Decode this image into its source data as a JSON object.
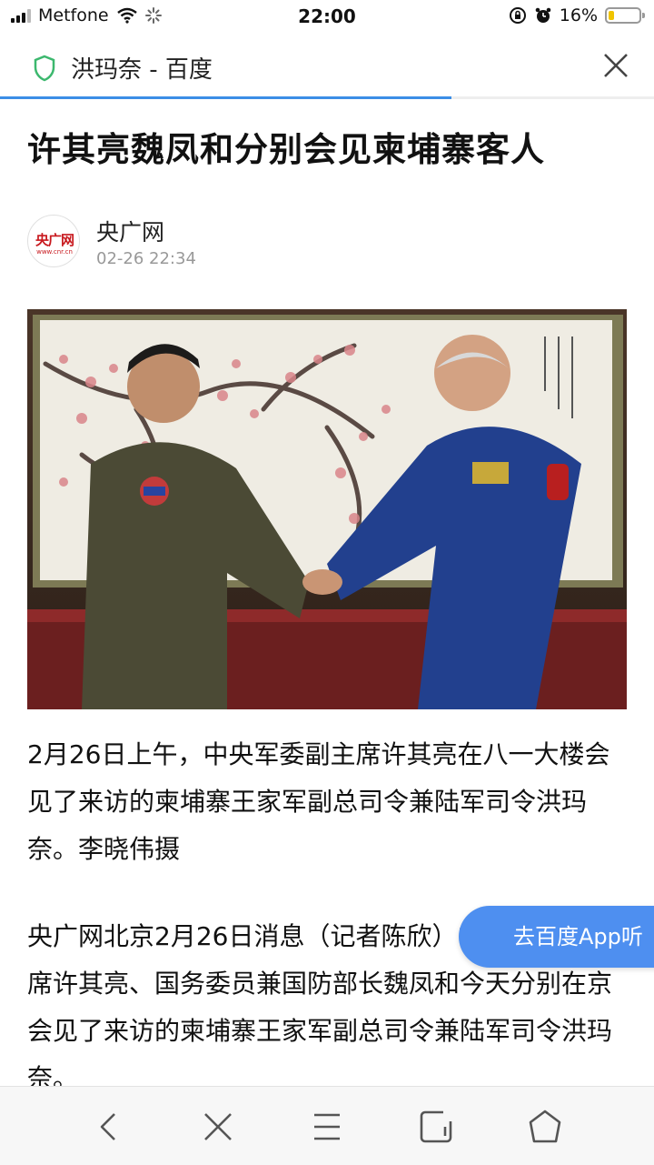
{
  "status_bar": {
    "carrier": "Metfone",
    "time": "22:00",
    "battery_percent": "16%",
    "battery_level": 0.16
  },
  "title_bar": {
    "title": "洪玛奈 - 百度",
    "secure_icon": "shield-icon",
    "close_icon": "close-icon",
    "load_progress": 0.69,
    "accent": "#3b8ee6"
  },
  "article": {
    "headline": "许其亮魏凤和分别会见柬埔寨客人",
    "source": {
      "logo_text": "央广网",
      "logo_subtext": "www.cnr.cn",
      "name": "央广网",
      "time": "02-26 22:34"
    },
    "caption": "2月26日上午，中央军委副主席许其亮在八一大楼会见了来访的柬埔寨王家军副总司令兼陆军司令洪玛奈。李晓伟摄",
    "body": "央广网北京2月26日消息（记者陈欣）中央军委副主席许其亮、国务委员兼国防部长魏凤和今天分别在京会见了来访的柬埔寨王家军副总司令兼陆军司令洪玛奈。"
  },
  "float_button": {
    "label": "去百度App听",
    "color": "#4e8ff0"
  },
  "bottom_nav": {
    "items": [
      "back-icon",
      "close-icon",
      "menu-icon",
      "tabs-icon",
      "home-icon"
    ]
  }
}
